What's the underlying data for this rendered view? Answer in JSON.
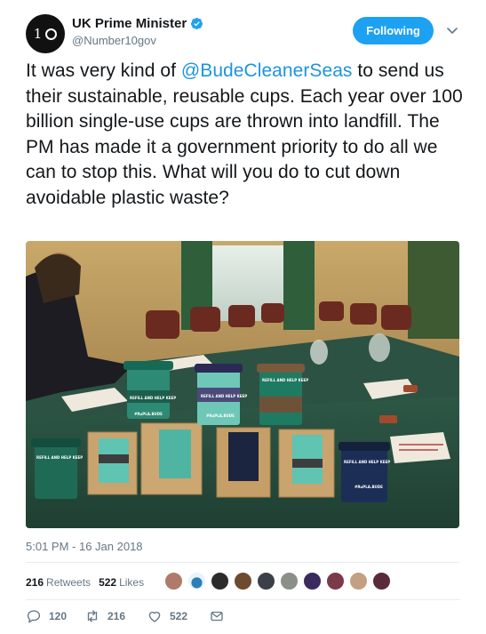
{
  "author": {
    "display_name": "UK Prime Minister",
    "handle": "@Number10gov",
    "avatar_text": "10",
    "verified": true
  },
  "follow_button_label": "Following",
  "tweet": {
    "text_before": "It was very kind of ",
    "mention": "@BudeCleanerSeas",
    "text_after": " to send us their sustainable, reusable cups. Each year over 100 billion single-use cups are thrown into landfill. The PM has made it a government priority to do all we can to stop this. What will you do to cut down avoidable plastic waste?",
    "timestamp": "5:01 PM - 16 Jan 2018"
  },
  "stats": {
    "retweets_count": "216",
    "retweets_label": "Retweets",
    "likes_count": "522",
    "likes_label": "Likes"
  },
  "actions": {
    "reply_count": "120",
    "retweet_count": "216",
    "like_count": "522"
  },
  "colors": {
    "accent": "#1da1f2",
    "link": "#1b95e0",
    "muted": "#657786"
  },
  "cup_labels": [
    "REFILL AND HELP KEEP",
    "#RuPLA.BUDE"
  ]
}
